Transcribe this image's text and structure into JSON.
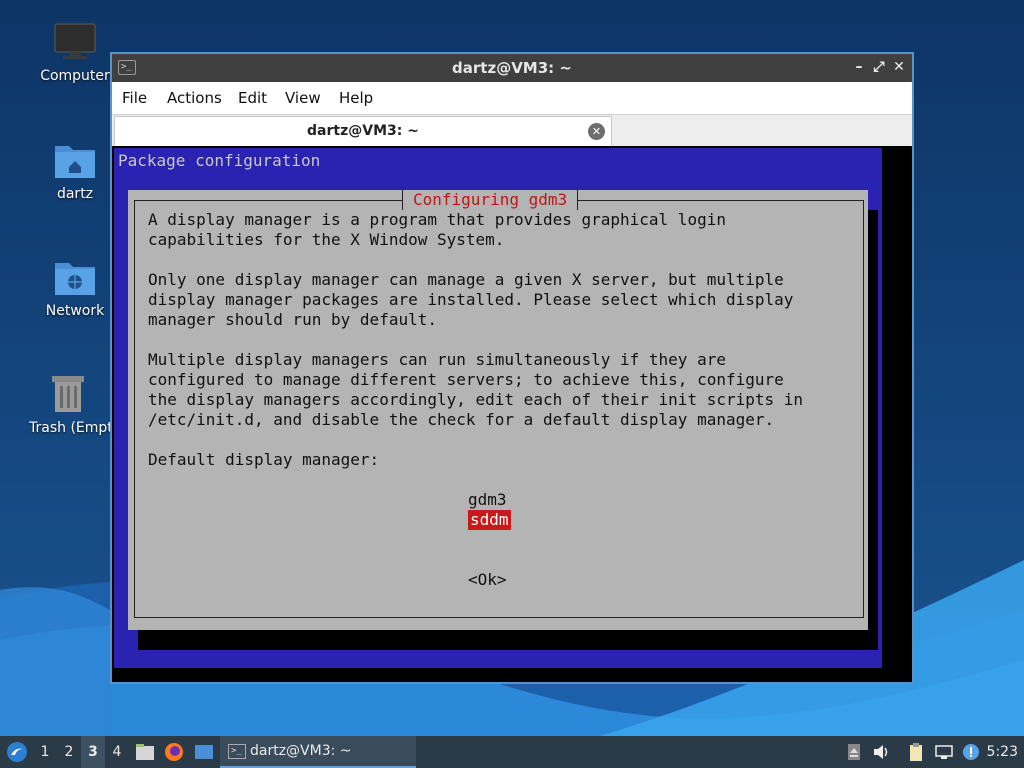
{
  "desktop": {
    "icons": [
      {
        "label": "Computer",
        "icon": "computer-icon"
      },
      {
        "label": "dartz",
        "icon": "home-folder-icon"
      },
      {
        "label": "Network",
        "icon": "network-folder-icon"
      },
      {
        "label": "Trash (Empty)",
        "icon": "trash-icon"
      }
    ]
  },
  "window": {
    "title": "dartz@VM3: ~",
    "controls": {
      "minimize": "–",
      "maximize": "⤢",
      "close": "✕"
    },
    "menu": [
      "File",
      "Actions",
      "Edit",
      "View",
      "Help"
    ],
    "tab": {
      "title": "dartz@VM3: ~",
      "close": "✕"
    }
  },
  "terminal": {
    "header": "Package configuration",
    "dialog": {
      "title": "Configuring gdm3",
      "lines": [
        "A display manager is a program that provides graphical login",
        "capabilities for the X Window System.",
        "",
        "Only one display manager can manage a given X server, but multiple",
        "display manager packages are installed. Please select which display",
        "manager should run by default.",
        "",
        "Multiple display managers can run simultaneously if they are",
        "configured to manage different servers; to achieve this, configure",
        "the display managers accordingly, edit each of their init scripts in",
        "/etc/init.d, and disable the check for a default display manager.",
        "",
        "Default display manager:"
      ],
      "options": [
        "gdm3",
        "sddm"
      ],
      "selected": "sddm",
      "ok_button": "<Ok>"
    }
  },
  "taskbar": {
    "workspaces": [
      "1",
      "2",
      "3",
      "4"
    ],
    "active_workspace": "3",
    "task": {
      "title": "dartz@VM3: ~"
    },
    "clock": "5:23"
  },
  "colors": {
    "dialog_bg": "#b4b4b4",
    "screen_bg": "#2a22b0",
    "title_red": "#c01515",
    "selected_bg": "#c71a1a"
  }
}
